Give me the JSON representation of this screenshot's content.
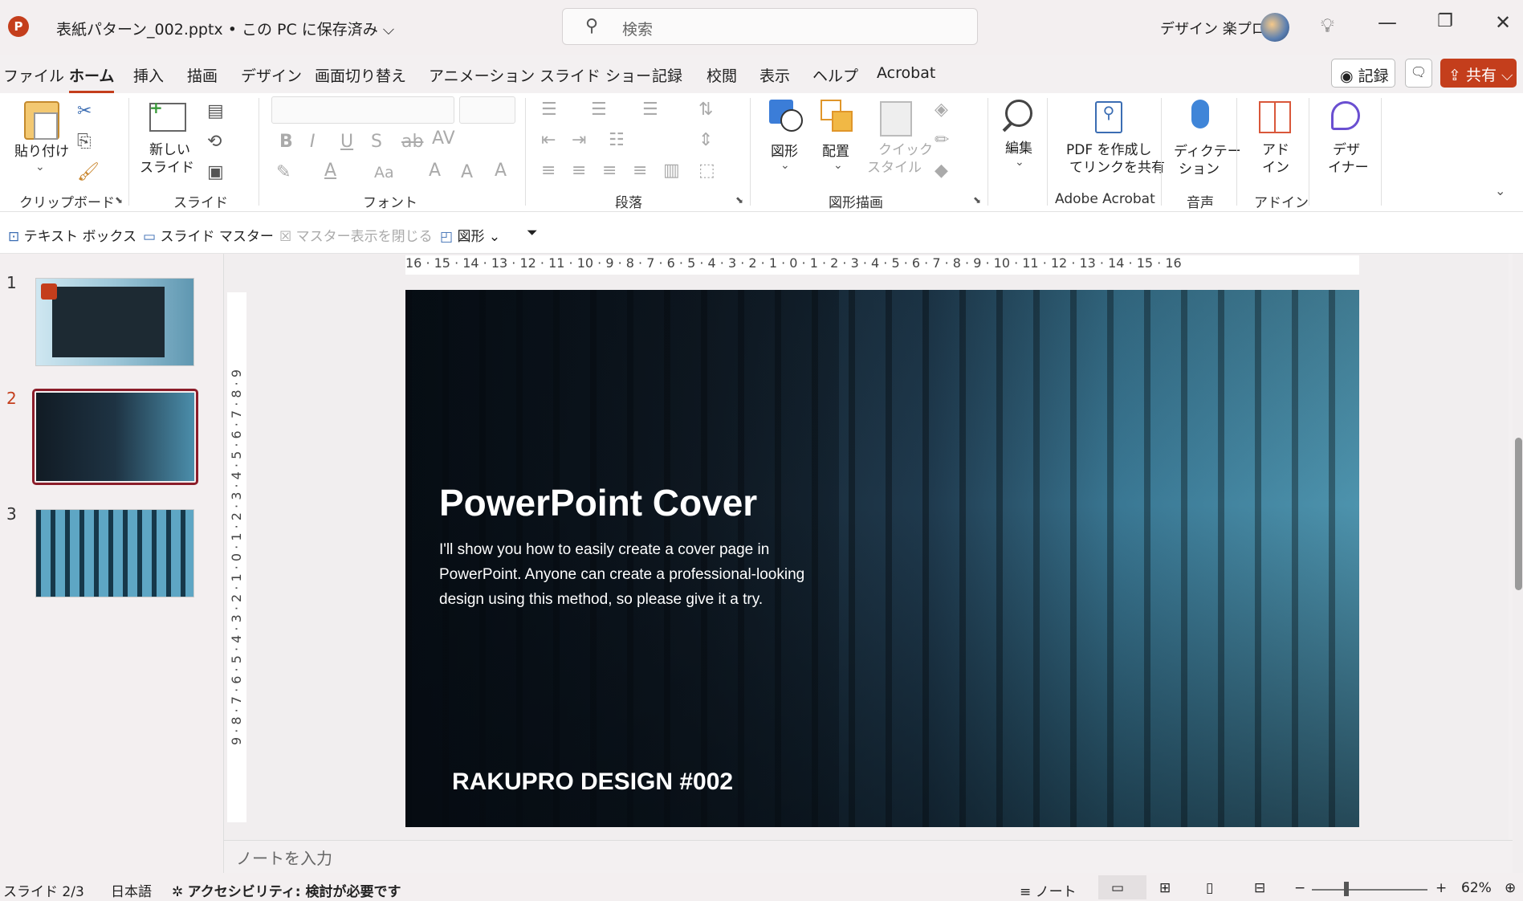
{
  "titlebar": {
    "app_icon": "P",
    "file_title": "表紙パターン_002.pptx • この PC に保存済み ⌵",
    "search_placeholder": "検索",
    "user_name": "デザイン 楽プロ",
    "icons": [
      "powerpoint-logo-icon",
      "search-icon",
      "lightbulb-icon",
      "minimize-icon",
      "restore-icon",
      "close-icon"
    ]
  },
  "menu": {
    "items": [
      "ファイル",
      "ホーム",
      "挿入",
      "描画",
      "デザイン",
      "画面切り替え",
      "アニメーション",
      "スライド ショー",
      "記録",
      "校閲",
      "表示",
      "ヘルプ",
      "Acrobat"
    ],
    "active": "ホーム",
    "record_label": "◉ 記録",
    "share_label": "⇪ 共有 ⌵"
  },
  "ribbon": {
    "groups": [
      "クリップボード",
      "スライド",
      "フォント",
      "段落",
      "図形描画",
      "Adobe Acrobat",
      "音声",
      "アドイン"
    ],
    "paste_label": "貼り付け",
    "new_slide_label_1": "新しい",
    "new_slide_label_2": "スライド",
    "shapes_label": "図形",
    "arrange_label": "配置",
    "quick_style_label_1": "クイック",
    "quick_style_label_2": "スタイル",
    "edit_label": "編集",
    "pdf_label_1": "PDF を作成し",
    "pdf_label_2": "てリンクを共有",
    "dictate_label_1": "ディクテー",
    "dictate_label_2": "ション",
    "addin_label_1": "アド",
    "addin_label_2": "イン",
    "designer_label_1": "デザ",
    "designer_label_2": "イナー",
    "font_aa_label": "Aa"
  },
  "quick_access": {
    "text_box": "テキスト ボックス",
    "slide_master": "スライド マスター",
    "close_master": "マスター表示を閉じる",
    "shapes": "図形"
  },
  "thumbnails": [
    {
      "number": "1"
    },
    {
      "number": "2",
      "selected": true
    },
    {
      "number": "3"
    }
  ],
  "ruler": {
    "horizontal": "16 · 15 · 14 · 13 · 12 · 11 · 10 · 9 · 8 · 7 · 6 · 5 · 4 · 3 · 2 · 1 · 0 · 1 · 2 · 3 · 4 · 5 · 6 · 7 · 8 · 9 · 10 · 11 · 12 · 13 · 14 · 15 · 16",
    "vertical": "9 · 8 · 7 · 6 · 5 · 4 · 3 · 2 · 1 · 0 · 1 · 2 · 3 · 4 · 5 · 6 · 7 · 8 · 9"
  },
  "slide": {
    "title": "PowerPoint Cover",
    "body": "I'll show you how to easily create a cover page in PowerPoint. Anyone can create a professional-looking design using this method, so please give it a try.",
    "footer": "RAKUPRO DESIGN #002"
  },
  "notes_placeholder": "ノートを入力",
  "status": {
    "slide_info": "スライド 2/3",
    "language": "日本語",
    "accessibility": "アクセシビリティ: 検討が必要です",
    "notes_label": "≡ ノート",
    "zoom": "62%"
  },
  "colors": {
    "accent": "#c43e1c",
    "selected_thumb": "#8b1d2a"
  }
}
